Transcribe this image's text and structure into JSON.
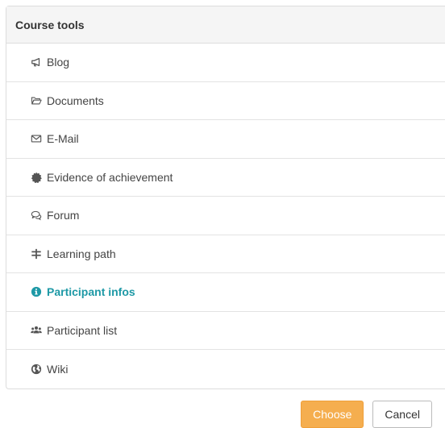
{
  "panel": {
    "title": "Course tools",
    "items": [
      {
        "label": "Blog",
        "icon": "megaphone-icon",
        "active": false
      },
      {
        "label": "Documents",
        "icon": "folder-open-icon",
        "active": false
      },
      {
        "label": "E-Mail",
        "icon": "envelope-icon",
        "active": false
      },
      {
        "label": "Evidence of achievement",
        "icon": "certificate-icon",
        "active": false
      },
      {
        "label": "Forum",
        "icon": "comments-icon",
        "active": false
      },
      {
        "label": "Learning path",
        "icon": "signpost-icon",
        "active": false
      },
      {
        "label": "Participant infos",
        "icon": "info-circle-icon",
        "active": true
      },
      {
        "label": "Participant list",
        "icon": "users-icon",
        "active": false
      },
      {
        "label": "Wiki",
        "icon": "globe-icon",
        "active": false
      }
    ]
  },
  "buttons": {
    "choose_label": "Choose",
    "cancel_label": "Cancel"
  },
  "colors": {
    "accent": "#1e99a6",
    "primary_button": "#f5ae4f",
    "header_bg": "#f5f5f5",
    "border": "#dddddd"
  }
}
